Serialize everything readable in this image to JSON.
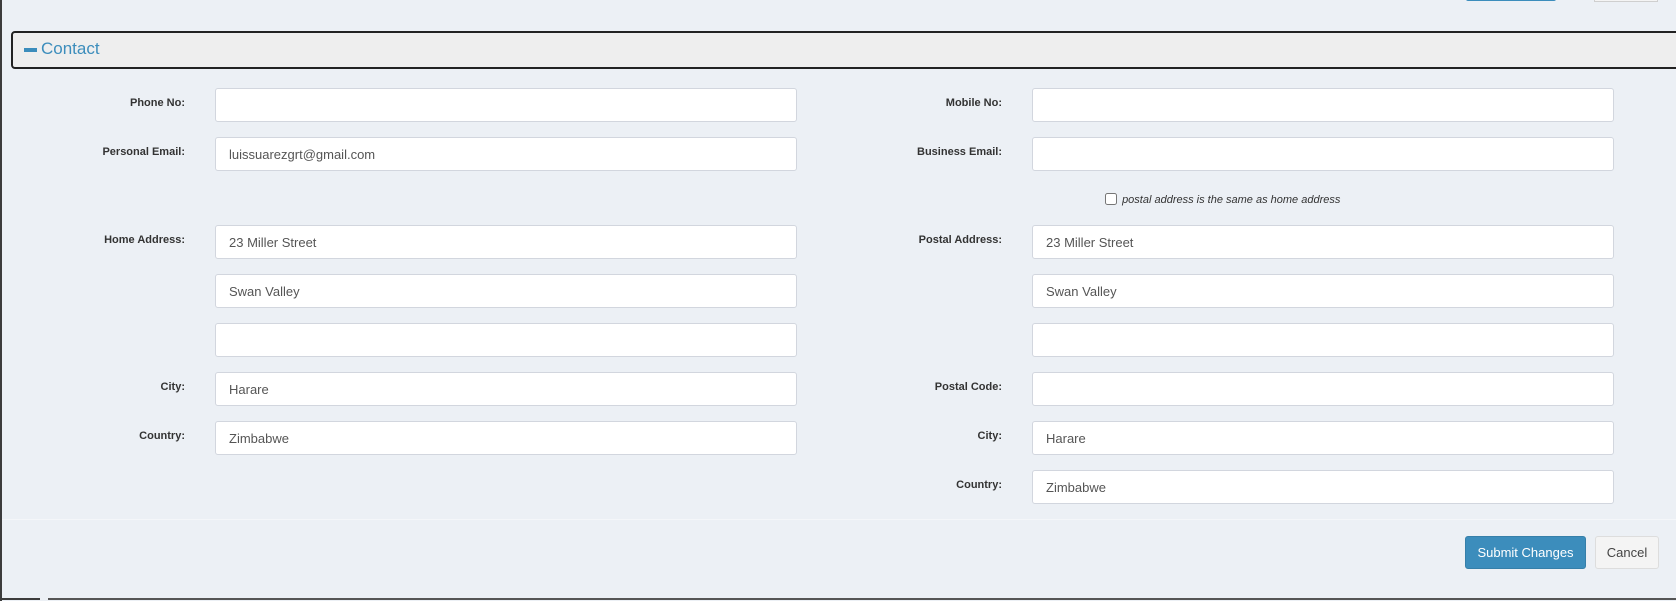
{
  "section": {
    "title": "Contact"
  },
  "left": {
    "phone": {
      "label": "Phone No:",
      "value": ""
    },
    "personal_email": {
      "label": "Personal Email:",
      "value": "luissuarezgrt@gmail.com"
    },
    "home_address": {
      "label": "Home Address:",
      "line1": "23 Miller Street",
      "line2": "Swan Valley",
      "line3": ""
    },
    "city": {
      "label": "City:",
      "value": "Harare"
    },
    "country": {
      "label": "Country:",
      "value": "Zimbabwe"
    }
  },
  "right": {
    "mobile": {
      "label": "Mobile No:",
      "value": ""
    },
    "business_email": {
      "label": "Business Email:",
      "value": ""
    },
    "same_as_home": {
      "label": "postal address is the same as home address",
      "checked": false
    },
    "postal_address": {
      "label": "Postal Address:",
      "line1": "23 Miller Street",
      "line2": "Swan Valley",
      "line3": ""
    },
    "postal_code": {
      "label": "Postal Code:",
      "value": ""
    },
    "city": {
      "label": "City:",
      "value": "Harare"
    },
    "country": {
      "label": "Country:",
      "value": "Zimbabwe"
    }
  },
  "actions": {
    "submit": "Submit Changes",
    "cancel": "Cancel"
  },
  "colors": {
    "accent": "#3c8dbc",
    "background": "#ecf0f5"
  }
}
